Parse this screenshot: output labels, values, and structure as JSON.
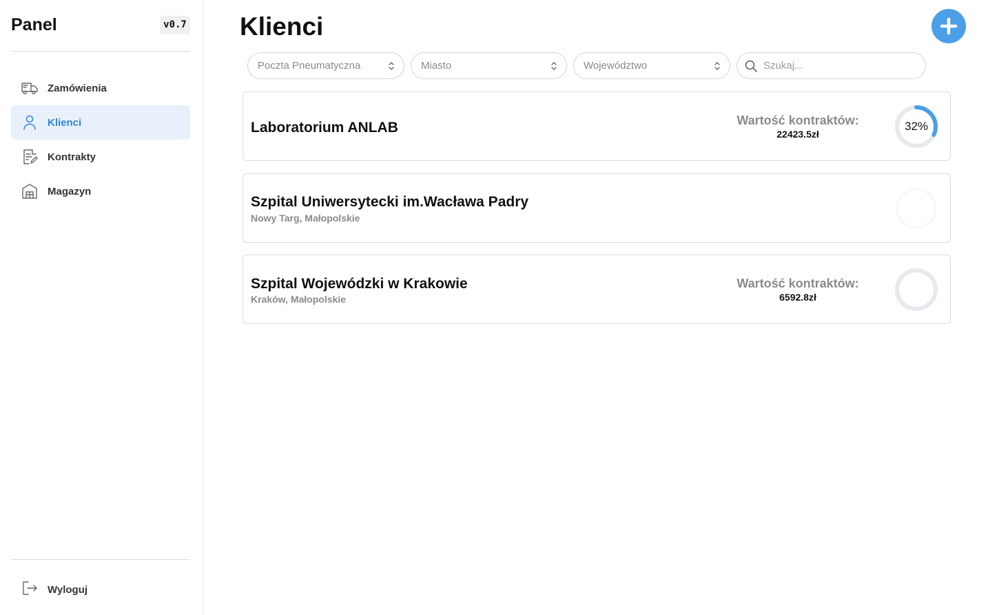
{
  "app": {
    "title": "Panel",
    "version": "v0.7"
  },
  "sidebar": {
    "items": [
      {
        "label": "Zamówienia",
        "icon": "truck-icon",
        "active": false
      },
      {
        "label": "Klienci",
        "icon": "user-icon",
        "active": true
      },
      {
        "label": "Kontrakty",
        "icon": "contract-icon",
        "active": false
      },
      {
        "label": "Magazyn",
        "icon": "warehouse-icon",
        "active": false
      }
    ],
    "logout_label": "Wyloguj"
  },
  "main": {
    "title": "Klienci",
    "add_button_icon": "plus-icon",
    "filters": [
      {
        "placeholder": "Poczta Pneumatyczna"
      },
      {
        "placeholder": "Miasto"
      },
      {
        "placeholder": "Województwo"
      }
    ],
    "search": {
      "placeholder": "Szukaj..."
    }
  },
  "clients": [
    {
      "name": "Laboratorium ANLAB",
      "location": "",
      "value_label": "Wartość kontraktów:",
      "value": "22423.5zł",
      "percent_label": "32%",
      "progress": 0.32
    },
    {
      "name": "Szpital Uniwersytecki im.Wacława Padry",
      "location": "Nowy Targ, Małopolskie",
      "value_label": "",
      "value": "",
      "percent_label": "",
      "progress": 0
    },
    {
      "name": "Szpital Wojewódzki w Krakowie",
      "location": "Kraków, Małopolskie",
      "value_label": "Wartość kontraktów:",
      "value": "6592.8zł",
      "percent_label": "",
      "progress": 0
    }
  ],
  "colors": {
    "accent": "#2f86dd",
    "button": "#4a9fe8",
    "ring_track": "#e6e9ed",
    "active_bg": "#e8f1fb"
  }
}
